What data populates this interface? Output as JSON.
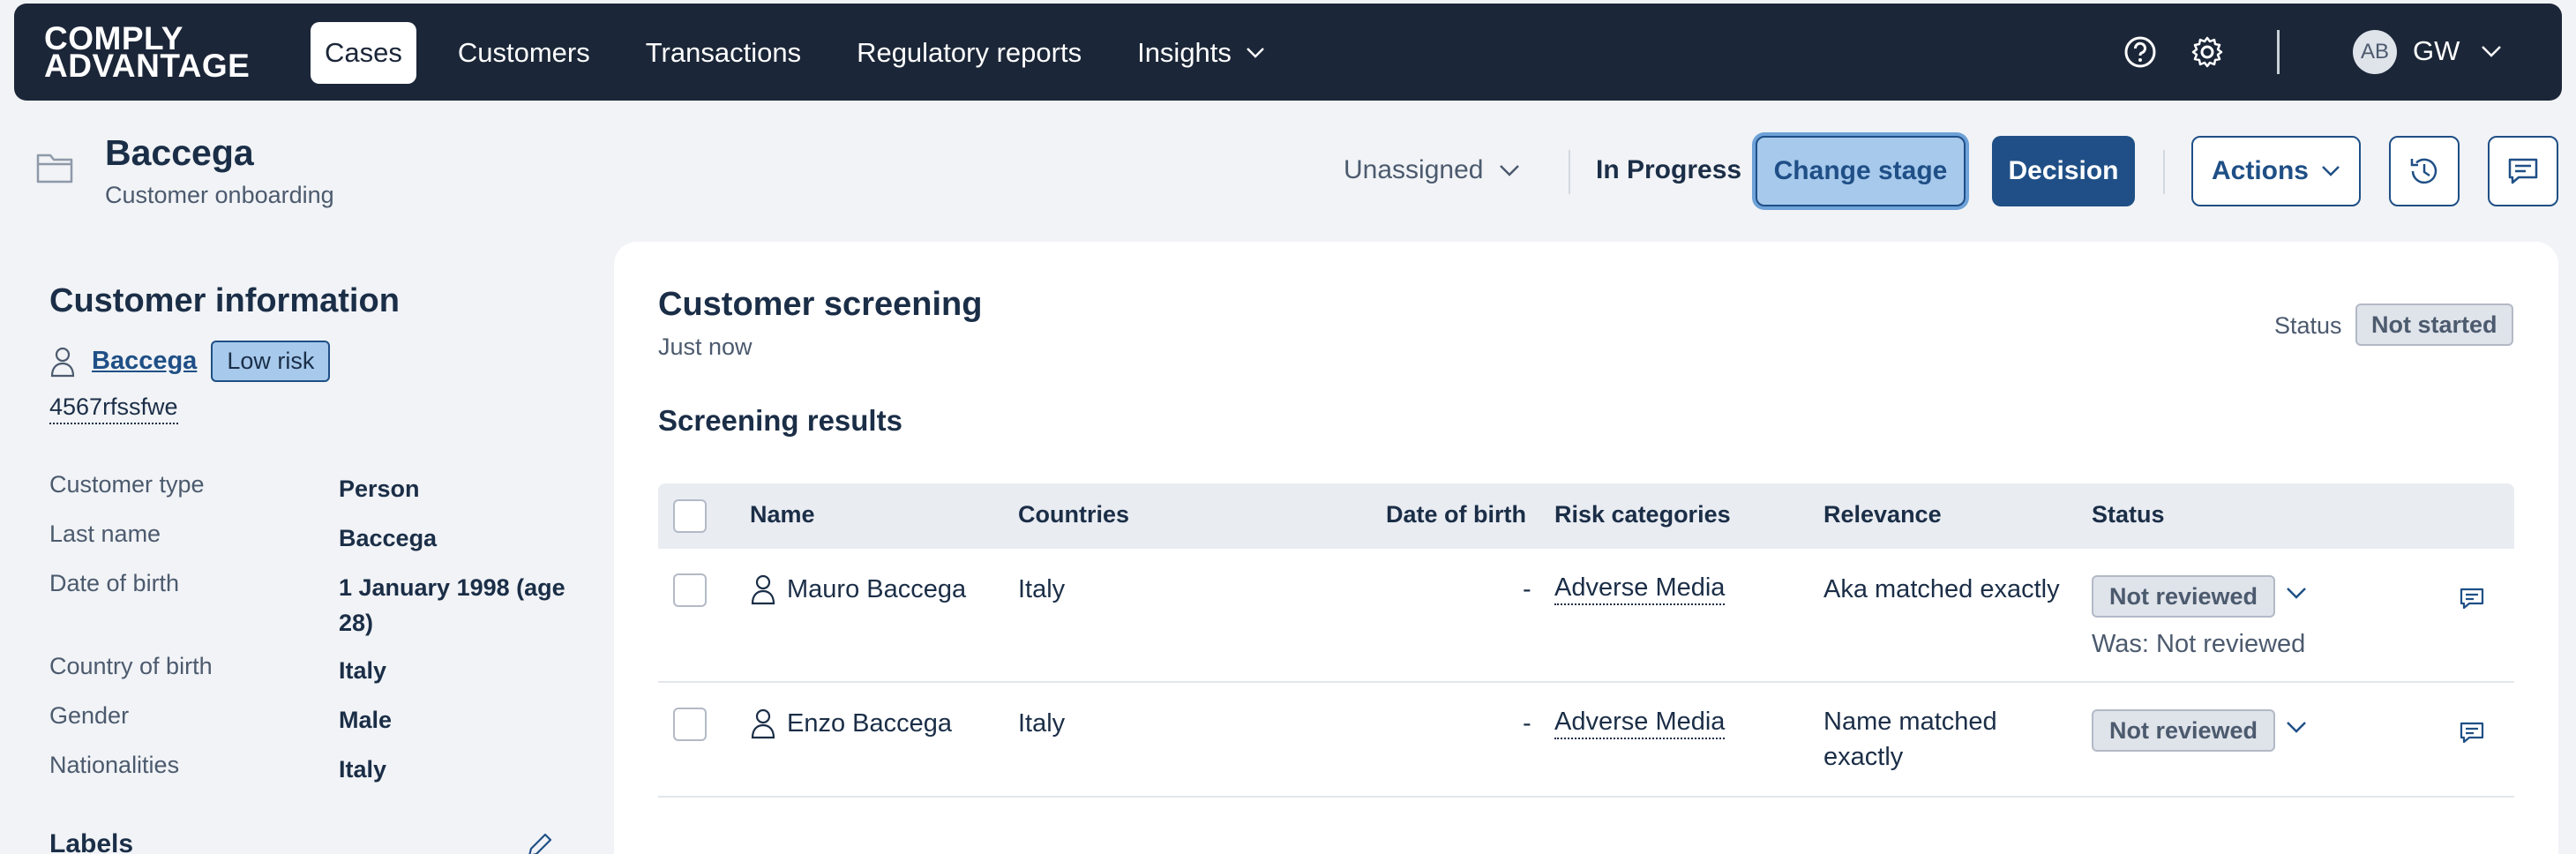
{
  "nav": {
    "logo_line1": "COMPLY",
    "logo_line2": "ADVANTAGE",
    "tabs": [
      {
        "label": "Cases",
        "active": true
      },
      {
        "label": "Customers"
      },
      {
        "label": "Transactions"
      },
      {
        "label": "Regulatory reports"
      },
      {
        "label": "Insights"
      }
    ],
    "help_icon": "help-circle-icon",
    "settings_icon": "gear-icon",
    "avatar_initials": "AB",
    "user_initials": "GW"
  },
  "case": {
    "title": "Baccega",
    "subtitle": "Customer onboarding",
    "assignee": "Unassigned",
    "status": "In Progress",
    "change_stage_label": "Change stage",
    "decision_label": "Decision",
    "actions_label": "Actions"
  },
  "customer": {
    "heading": "Customer information",
    "name": "Baccega",
    "risk": "Low risk",
    "id": "4567rfssfwe",
    "fields": [
      {
        "label": "Customer type",
        "value": "Person"
      },
      {
        "label": "Last name",
        "value": "Baccega"
      },
      {
        "label": "Date of birth",
        "value": "1 January 1998 (age 28)"
      },
      {
        "label": "Country of birth",
        "value": "Italy"
      },
      {
        "label": "Gender",
        "value": "Male"
      },
      {
        "label": "Nationalities",
        "value": "Italy"
      }
    ],
    "labels_heading": "Labels"
  },
  "screening": {
    "title": "Customer screening",
    "time": "Just now",
    "status_label": "Status",
    "status": "Not started",
    "results_heading": "Screening results",
    "columns": [
      "Name",
      "Countries",
      "Date of birth",
      "Risk categories",
      "Relevance",
      "Status"
    ],
    "rows": [
      {
        "name": "Mauro Baccega",
        "country": "Italy",
        "dob": "-",
        "risk": "Adverse Media",
        "relevance": "Aka matched exactly",
        "status": "Not reviewed",
        "was": "Was: Not reviewed"
      },
      {
        "name": "Enzo Baccega",
        "country": "Italy",
        "dob": "-",
        "risk": "Adverse Media",
        "relevance": "Name matched exactly",
        "status": "Not reviewed"
      }
    ]
  },
  "colors": {
    "nav_bg": "#1b2638",
    "primary": "#1f4f86",
    "accent_light": "#a6c9ec",
    "page_bg": "#f1f3f6"
  }
}
